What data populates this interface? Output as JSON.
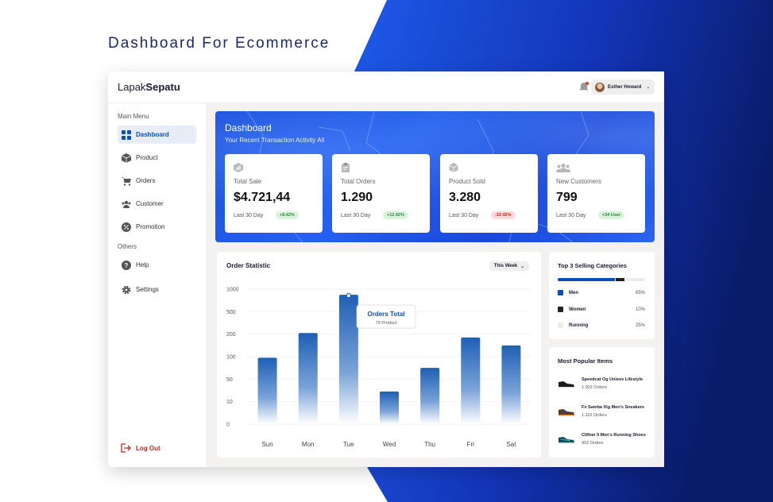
{
  "headline": "Dashboard For Ecommerce",
  "colors": {
    "brand_blue": "#0a4fb5",
    "banner_blue": "#1f55e8",
    "bg_dark": "#0c1f6e",
    "danger": "#c0271f",
    "success": "#2b8a3e"
  },
  "topbar": {
    "logo_regular": "Lapak",
    "logo_bold": "Sepatu",
    "notification_icon": "bell-icon",
    "user_name": "Esther Howard"
  },
  "sidebar": {
    "main_menu_label": "Main Menu",
    "main_items": [
      {
        "label": "Dashboard",
        "icon": "grid-icon",
        "active": true
      },
      {
        "label": "Product",
        "icon": "box-icon"
      },
      {
        "label": "Orders",
        "icon": "cart-icon"
      },
      {
        "label": "Customer",
        "icon": "users-icon"
      },
      {
        "label": "Promotion",
        "icon": "percent-icon"
      }
    ],
    "others_label": "Others",
    "other_items": [
      {
        "label": "Help",
        "icon": "help-icon"
      },
      {
        "label": "Settings",
        "icon": "gear-icon"
      }
    ],
    "logout_label": "Log Out"
  },
  "banner": {
    "title": "Dashboard",
    "subtitle": "Your Recent Transaction Activity All"
  },
  "stats": [
    {
      "label": "Total Sale",
      "value": "$4.721,44",
      "period": "Last 30 Day",
      "badge": "+8.42%",
      "trend": "up",
      "icon": "chart-box-icon"
    },
    {
      "label": "Total Orders",
      "value": "1.290",
      "period": "Last 30 Day",
      "badge": "+12.42%",
      "trend": "up",
      "icon": "clipboard-icon"
    },
    {
      "label": "Product Sold",
      "value": "3.280",
      "period": "Last 30 Day",
      "badge": "-12.42%",
      "trend": "down",
      "icon": "cube-icon"
    },
    {
      "label": "New Customers",
      "value": "799",
      "period": "Last 30 Day",
      "badge": "+34 User",
      "trend": "up",
      "icon": "group-icon"
    }
  ],
  "order_statistic": {
    "title": "Order Statistic",
    "period_select": "This Week",
    "tooltip_title": "Orders Total",
    "tooltip_sub": "79 Product"
  },
  "chart_data": {
    "type": "bar",
    "categories": [
      "Sun",
      "Mon",
      "Tue",
      "Wed",
      "Thu",
      "Fri",
      "Sat"
    ],
    "y_ticks": [
      "1000",
      "500",
      "200",
      "100",
      "50",
      "10",
      "0"
    ],
    "values": [
      2.95,
      4.05,
      5.75,
      1.45,
      2.5,
      3.85,
      3.5
    ],
    "value_scale": "tick index (0 = '0', 6 = '1000'), estimated",
    "highlighted": "Tue",
    "bar_color": "#1f5fb5",
    "grid": true
  },
  "categories_panel": {
    "title": "Top 3 Selling Categories",
    "items": [
      {
        "name": "Men",
        "pct": "65%",
        "share": 0.65,
        "color": "#0a4fb5"
      },
      {
        "name": "Women",
        "pct": "10%",
        "share": 0.1,
        "color": "#222222"
      },
      {
        "name": "Running",
        "pct": "25%",
        "share": 0.25,
        "color": "#ececec"
      }
    ]
  },
  "popular_panel": {
    "title": "Most Popular Items",
    "items": [
      {
        "name": "Speedcat Og Unisex Lifestyle",
        "orders": "1.902 Orders",
        "icon": "sneaker-black-icon"
      },
      {
        "name": "Fx Samba Xlg Men's Sneakers",
        "orders": "1.110 Orders",
        "icon": "sneaker-brown-icon"
      },
      {
        "name": "Clifton 9 Men's Running Shoes",
        "orders": "902 Orders",
        "icon": "sneaker-teal-icon"
      }
    ]
  }
}
